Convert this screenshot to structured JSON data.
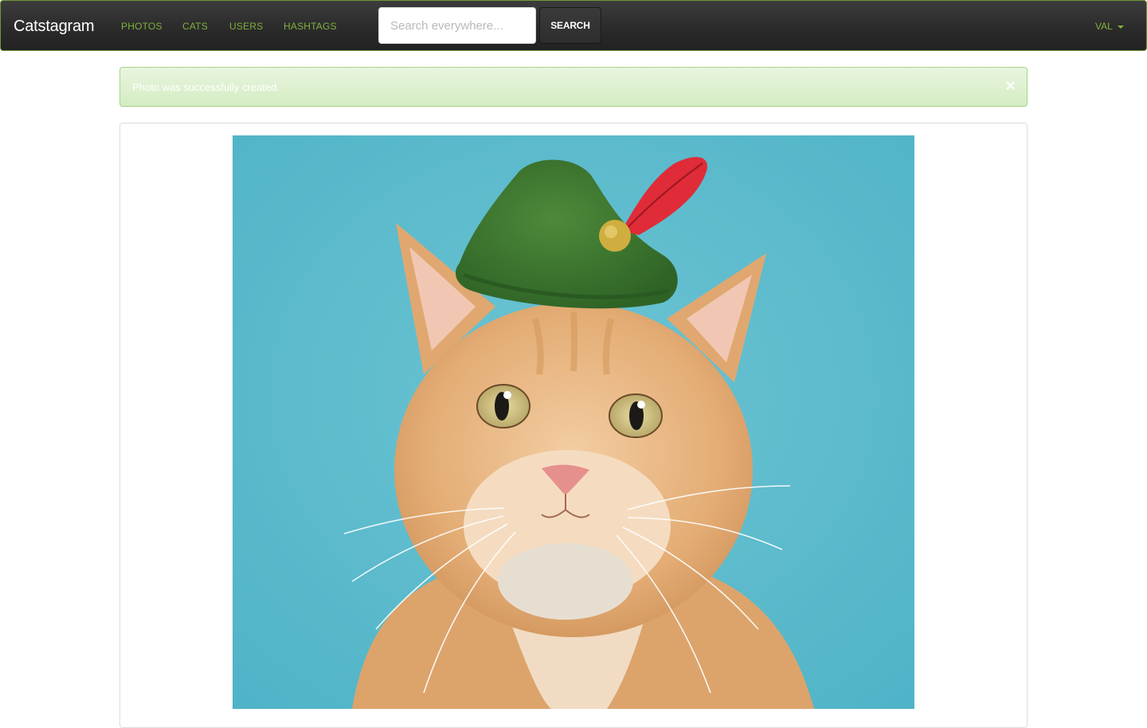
{
  "navbar": {
    "brand": "Catstagram",
    "links": [
      {
        "label": "PHOTOS"
      },
      {
        "label": "CATS"
      },
      {
        "label": "USERS"
      },
      {
        "label": "HASHTAGS"
      }
    ],
    "search": {
      "placeholder": "Search everywhere...",
      "button_label": "SEARCH"
    },
    "user_menu": {
      "label": "VAL",
      "icon": "caret-down-icon"
    },
    "colors": {
      "accent": "#7fb13f",
      "background": "#2b2b2b"
    }
  },
  "alert": {
    "message": "Photo was successfully created.",
    "close_glyph": "×",
    "color": "#dcefcd"
  },
  "photo": {
    "subject": "orange tabby cat wearing green felt hat with red feather",
    "background_color": "#5dbccd"
  }
}
